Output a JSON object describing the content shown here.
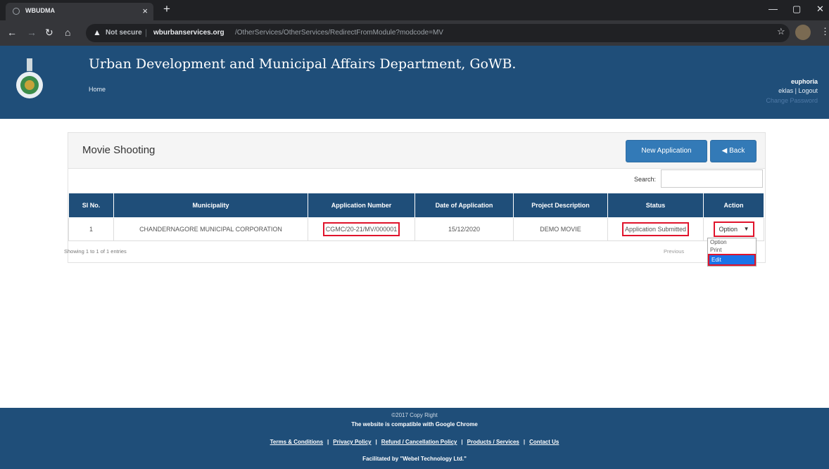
{
  "browser": {
    "tab_title": "WBUDMA",
    "tab_close": "×",
    "new_tab": "+",
    "not_secure": "Not secure",
    "url_separator": "|",
    "url_domain": "wburbanservices.org",
    "url_path": "/OtherServices/OtherServices/RedirectFromModule?modcode=MV",
    "minimize": "—",
    "maximize": "▢",
    "close": "✕"
  },
  "header": {
    "title": "Urban Development and Municipal Affairs Department, GoWB.",
    "home": "Home",
    "user_name": "euphoria",
    "user_links": "eklas | Logout",
    "change_password": "Change Password"
  },
  "panel": {
    "title": "Movie Shooting",
    "new_application": "New Application",
    "back": "◀ Back",
    "search_label": "Search:"
  },
  "table": {
    "columns": [
      "Sl No.",
      "Municipality",
      "Application Number",
      "Date of Application",
      "Project Description",
      "Status",
      "Action"
    ],
    "rows": [
      {
        "sl": "1",
        "municipality": "CHANDERNAGORE MUNICIPAL CORPORATION",
        "app_number": "CGMC/20-21/MV/000001",
        "date": "15/12/2020",
        "description": "DEMO MOVIE",
        "status": "Application Submitted",
        "action": "Option"
      }
    ],
    "info": "Showing 1 to 1 of 1 entries",
    "previous": "Previous"
  },
  "dropdown_options": [
    "Option",
    "Print",
    "Edit"
  ],
  "footer": {
    "copyright": "©2017 Copy Right",
    "compat": "The website is compatible with Google Chrome",
    "links": [
      "Terms & Conditions",
      "Privacy Policy",
      "Refund / Cancellation Policy",
      "Products / Services",
      "Contact Us"
    ],
    "link_separator": "|",
    "facilitated": "Facilitated by \"Webel Technology Ltd.\""
  }
}
